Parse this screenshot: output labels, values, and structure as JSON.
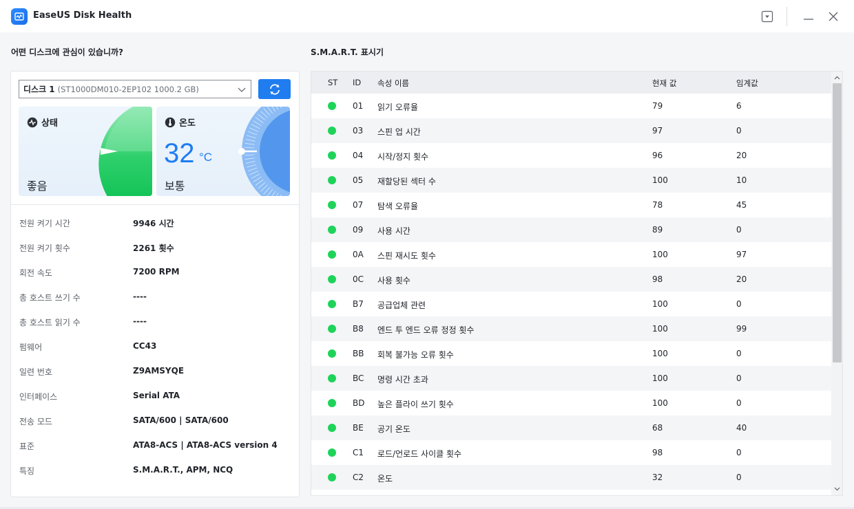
{
  "window": {
    "title": "EaseUS Disk Health"
  },
  "left": {
    "heading": "어떤 디스크에 관심이 있습니까?",
    "disk_name": "디스크 1",
    "disk_model": "(ST1000DM010-2EP102 1000.2 GB)",
    "status_card": {
      "label": "상태",
      "state": "좋음",
      "icon": "pulse-icon",
      "color": "#1ec85f"
    },
    "temp_card": {
      "label": "온도",
      "value": "32",
      "unit": "°C",
      "state": "보통",
      "icon": "thermometer-icon",
      "color": "#1f7df0"
    },
    "info": [
      {
        "key": "전원 켜기 시간",
        "value": "9946 시간"
      },
      {
        "key": "전원 켜기 횟수",
        "value": "2261 횟수"
      },
      {
        "key": "회전 속도",
        "value": "7200 RPM"
      },
      {
        "key": "총 호스트 쓰기 수",
        "value": "----"
      },
      {
        "key": "총 호스트 읽기 수",
        "value": "----"
      },
      {
        "key": "펌웨어",
        "value": "CC43"
      },
      {
        "key": "일련 번호",
        "value": "Z9AMSYQE"
      },
      {
        "key": "인터페이스",
        "value": "Serial ATA"
      },
      {
        "key": "전송 모드",
        "value": "SATA/600 | SATA/600"
      },
      {
        "key": "표준",
        "value": "ATA8-ACS | ATA8-ACS version 4"
      },
      {
        "key": "특징",
        "value": "S.M.A.R.T., APM, NCQ"
      }
    ]
  },
  "smart": {
    "heading": "S.M.A.R.T. 표시기",
    "headers": {
      "st": "ST",
      "id": "ID",
      "name": "속성 이름",
      "current": "현재 값",
      "threshold": "임계값"
    },
    "status_color": "#1fd35a",
    "rows": [
      {
        "id": "01",
        "name": "읽기 오류율",
        "current": "79",
        "threshold": "6"
      },
      {
        "id": "03",
        "name": "스핀 업 시간",
        "current": "97",
        "threshold": "0"
      },
      {
        "id": "04",
        "name": "시작/정지 횟수",
        "current": "96",
        "threshold": "20"
      },
      {
        "id": "05",
        "name": "재할당된 섹터 수",
        "current": "100",
        "threshold": "10"
      },
      {
        "id": "07",
        "name": "탐색 오류율",
        "current": "78",
        "threshold": "45"
      },
      {
        "id": "09",
        "name": "사용 시간",
        "current": "89",
        "threshold": "0"
      },
      {
        "id": "0A",
        "name": "스핀 재시도 횟수",
        "current": "100",
        "threshold": "97"
      },
      {
        "id": "0C",
        "name": "사용 횟수",
        "current": "98",
        "threshold": "20"
      },
      {
        "id": "B7",
        "name": "공급업체 관련",
        "current": "100",
        "threshold": "0"
      },
      {
        "id": "B8",
        "name": "엔드 투 엔드 오류 정정 횟수",
        "current": "100",
        "threshold": "99"
      },
      {
        "id": "BB",
        "name": "회복 불가능 오류 횟수",
        "current": "100",
        "threshold": "0"
      },
      {
        "id": "BC",
        "name": "명령 시간 초과",
        "current": "100",
        "threshold": "0"
      },
      {
        "id": "BD",
        "name": "높은 플라이 쓰기 횟수",
        "current": "100",
        "threshold": "0"
      },
      {
        "id": "BE",
        "name": "공기 온도",
        "current": "68",
        "threshold": "40"
      },
      {
        "id": "C1",
        "name": "로드/언로드 사이클 횟수",
        "current": "98",
        "threshold": "0"
      },
      {
        "id": "C2",
        "name": "온도",
        "current": "32",
        "threshold": "0"
      }
    ]
  }
}
